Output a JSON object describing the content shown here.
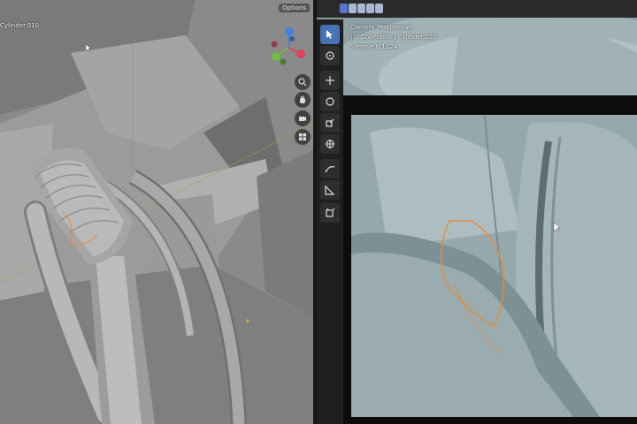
{
  "left_viewport": {
    "options_label": "Options",
    "object_label": "Cylinder.010",
    "nav_icons": [
      "zoom-icon",
      "hand-pan-icon",
      "camera-icon",
      "grid-icon"
    ]
  },
  "right_viewport": {
    "view_name": "Camera Perspective",
    "collection": "(1) Collection | Cylinder.010",
    "sample": "Sample 8/1024"
  },
  "toolbar": {
    "tools": [
      "select-box-icon",
      "cursor-icon",
      "move-icon",
      "rotate-icon",
      "scale-icon",
      "transform-icon",
      "annotate-icon",
      "measure-icon",
      "add-cube-icon"
    ]
  },
  "colors": {
    "accent": "#4772b3",
    "selection": "#e88a3a",
    "axis_x": "#e0405a",
    "axis_y": "#6fbf3f",
    "axis_z": "#4a7de0"
  }
}
